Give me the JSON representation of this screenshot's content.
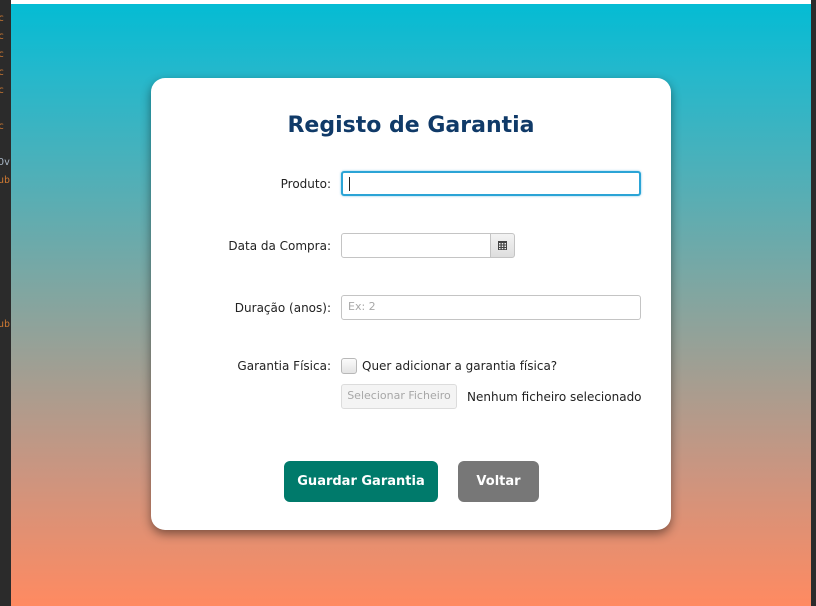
{
  "editor_fragments": [
    "c",
    "c",
    "c",
    "c",
    "c",
    "c",
    "Ov",
    "ub",
    "ub"
  ],
  "form": {
    "title": "Registo de Garantia",
    "product": {
      "label": "Produto:",
      "value": ""
    },
    "purchase_date": {
      "label": "Data da Compra:",
      "value": "",
      "icon": "calendar-icon"
    },
    "duration": {
      "label": "Duração (anos):",
      "placeholder": "Ex: 2",
      "value": ""
    },
    "physical_warranty": {
      "label": "Garantia Física:",
      "checkbox_label": "Quer adicionar a garantia física?",
      "checked": false,
      "file_button": "Selecionar Ficheiro",
      "file_status": "Nenhum ficheiro selecionado"
    },
    "save_button": "Guardar Garantia",
    "back_button": "Voltar"
  },
  "colors": {
    "title": "#103a68",
    "save_button": "#007a6b",
    "back_button": "#777777",
    "gradient_top": "#02bcd4",
    "gradient_bottom": "#ff8a61",
    "focus_border": "#2ba4d6"
  }
}
